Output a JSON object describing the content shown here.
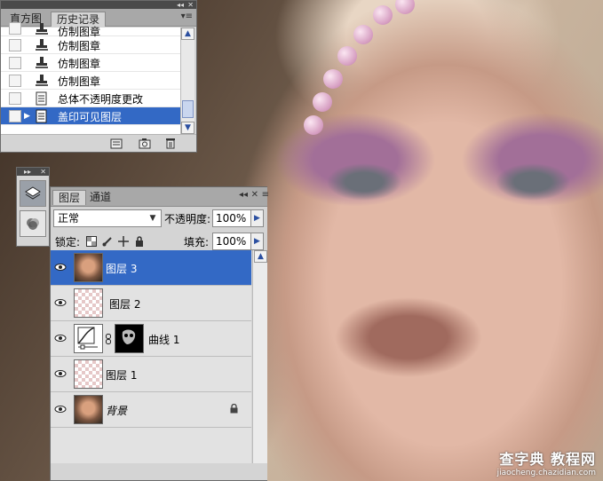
{
  "watermark": {
    "main": "查字典 教程网",
    "sub": "jiaocheng.chazidian.com"
  },
  "history": {
    "tabs": [
      "直方图",
      "历史记录"
    ],
    "active_tab": 1,
    "items": [
      {
        "label": "仿制图章",
        "icon": "clone-stamp-icon"
      },
      {
        "label": "仿制图章",
        "icon": "clone-stamp-icon"
      },
      {
        "label": "仿制图章",
        "icon": "clone-stamp-icon"
      },
      {
        "label": "仿制图章",
        "icon": "clone-stamp-icon"
      },
      {
        "label": "总体不透明度更改",
        "icon": "history-state-icon"
      },
      {
        "label": "盖印可见图层",
        "icon": "history-state-icon",
        "selected": true
      }
    ],
    "footer_icons": [
      "new-document-from-state-icon",
      "snapshot-camera-icon",
      "trash-icon"
    ]
  },
  "layers_panel": {
    "tabs": [
      "图层",
      "通道"
    ],
    "active_tab": 0,
    "blend_mode": "正常",
    "opacity_label": "不透明度:",
    "opacity_value": "100%",
    "lock_label": "锁定:",
    "fill_label": "填充:",
    "fill_value": "100%",
    "layers": [
      {
        "name": "图层 3",
        "thumb": "face",
        "visible": true,
        "selected": true
      },
      {
        "name": "图层 2",
        "thumb": "checker",
        "visible": true
      },
      {
        "name": "曲线 1",
        "thumb": "curves-adjustment",
        "mask": true,
        "visible": true
      },
      {
        "name": "图层 1",
        "thumb": "checker",
        "visible": true
      },
      {
        "name": "背景",
        "thumb": "face",
        "visible": true,
        "locked": true,
        "italic": true
      }
    ]
  },
  "colors": {
    "selection": "#3369c5",
    "panel": "#d4d4d4",
    "titlebar": "#4a4a4a"
  }
}
